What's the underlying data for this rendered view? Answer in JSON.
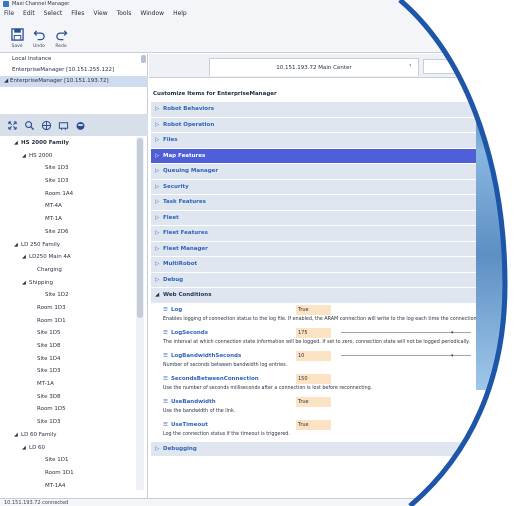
{
  "window": {
    "title": "Maxi Channel Manager"
  },
  "menu": [
    "File",
    "Edit",
    "Select",
    "Files",
    "View",
    "Tools",
    "Window",
    "Help"
  ],
  "toolbar": {
    "save_label": "Save",
    "undo_label": "Undo",
    "redo_label": "Redo"
  },
  "connections": [
    "Local Instance",
    "EnterpriseManager [10.151.255.122]",
    "EnterpriseManager [10.151.193.72]"
  ],
  "tree": [
    {
      "label": "HS 2000 Family",
      "toggle": "◢",
      "indent": 1,
      "bold": true
    },
    {
      "label": "HS 2000",
      "toggle": "◢",
      "indent": 2
    },
    {
      "label": "Site 1D3",
      "toggle": "",
      "indent": 4
    },
    {
      "label": "Site 1D3",
      "toggle": "",
      "indent": 4
    },
    {
      "label": "Room 1A4",
      "toggle": "",
      "indent": 4
    },
    {
      "label": "MT-4A",
      "toggle": "",
      "indent": 4
    },
    {
      "label": "MT-1A",
      "toggle": "",
      "indent": 4
    },
    {
      "label": "Site 2D6",
      "toggle": "",
      "indent": 4
    },
    {
      "label": "LD 250 Family",
      "toggle": "◢",
      "indent": 1
    },
    {
      "label": "LD250 Main 4A",
      "toggle": "◢",
      "indent": 2
    },
    {
      "label": "Charging",
      "toggle": "",
      "indent": 3
    },
    {
      "label": "Shipping",
      "toggle": "◢",
      "indent": 2
    },
    {
      "label": "Site 1D2",
      "toggle": "",
      "indent": 4
    },
    {
      "label": "Room 1D3",
      "toggle": "",
      "indent": 3
    },
    {
      "label": "Room 1D1",
      "toggle": "",
      "indent": 3
    },
    {
      "label": "Site 1D5",
      "toggle": "",
      "indent": 3
    },
    {
      "label": "Site 1D8",
      "toggle": "",
      "indent": 3
    },
    {
      "label": "Site 1D4",
      "toggle": "",
      "indent": 3
    },
    {
      "label": "Site 1D3",
      "toggle": "",
      "indent": 3
    },
    {
      "label": "MT-1A",
      "toggle": "",
      "indent": 3
    },
    {
      "label": "Site 3D8",
      "toggle": "",
      "indent": 3
    },
    {
      "label": "Room 1D5",
      "toggle": "",
      "indent": 3
    },
    {
      "label": "Site 1D3",
      "toggle": "",
      "indent": 3
    },
    {
      "label": "LD 60 Family",
      "toggle": "◢",
      "indent": 1
    },
    {
      "label": "LD 60",
      "toggle": "◢",
      "indent": 2
    },
    {
      "label": "Site 1D1",
      "toggle": "",
      "indent": 4
    },
    {
      "label": "Room 1D1",
      "toggle": "",
      "indent": 4
    },
    {
      "label": "MT-1A4",
      "toggle": "",
      "indent": 4
    },
    {
      "label": "Site 2D",
      "toggle": "",
      "indent": 4
    },
    {
      "label": "Room 1D1",
      "toggle": "",
      "indent": 4
    }
  ],
  "status": "10.151.193.72 connected",
  "tab": {
    "label": "10.151.193.72 Main Center",
    "close": "‹"
  },
  "page_title": "Customize Items for EnterpriseManager",
  "sections": [
    {
      "label": "Robot Behaviors",
      "arrow": "▷"
    },
    {
      "label": "Robot Operation",
      "arrow": "▷"
    },
    {
      "label": "Files",
      "arrow": "▷"
    },
    {
      "label": "Map Features",
      "arrow": "▷",
      "active": true
    },
    {
      "label": "Queuing Manager",
      "arrow": "▷"
    },
    {
      "label": "Security",
      "arrow": "▷"
    },
    {
      "label": "Task Features",
      "arrow": "▷"
    },
    {
      "label": "Fleet",
      "arrow": "▷"
    },
    {
      "label": "Fleet Features",
      "arrow": "▷"
    },
    {
      "label": "Fleet Manager",
      "arrow": "▷"
    },
    {
      "label": "MultiRobot",
      "arrow": "▷"
    },
    {
      "label": "Debug",
      "arrow": "▷"
    },
    {
      "label": "Web Conditions",
      "arrow": "◢",
      "expanded": true
    }
  ],
  "properties": [
    {
      "name": "Log",
      "value": "True",
      "desc": "Enables logging of connection status to the log file. If enabled, the ARAM connection will write to the log each time the connection state changes."
    },
    {
      "name": "LogSeconds",
      "value": "175",
      "desc": "The interval at which connection state information will be logged. If set to zero, connection state will not be logged periodically.",
      "slider": true
    },
    {
      "name": "LogBandwidthSeconds",
      "value": "10",
      "desc": "Number of seconds between bandwidth log entries.",
      "slider": true
    },
    {
      "name": "SecondsBetweenConnection",
      "value": "150",
      "desc": "Use the number of seconds milliseconds after a connection is lost before reconnecting."
    },
    {
      "name": "UseBandwidth",
      "value": "True",
      "desc": "Use the bandwidth of the link."
    },
    {
      "name": "UseTimeout",
      "value": "True",
      "desc": "Log the connection status if the timeout is triggered."
    }
  ],
  "bottom_section": {
    "label": "Debugging",
    "arrow": "▷"
  },
  "colors": {
    "accent": "#2d62b8",
    "active_row": "#4f5fd7",
    "value_bg": "#fbe3c3",
    "frame": "#1d56a8"
  }
}
